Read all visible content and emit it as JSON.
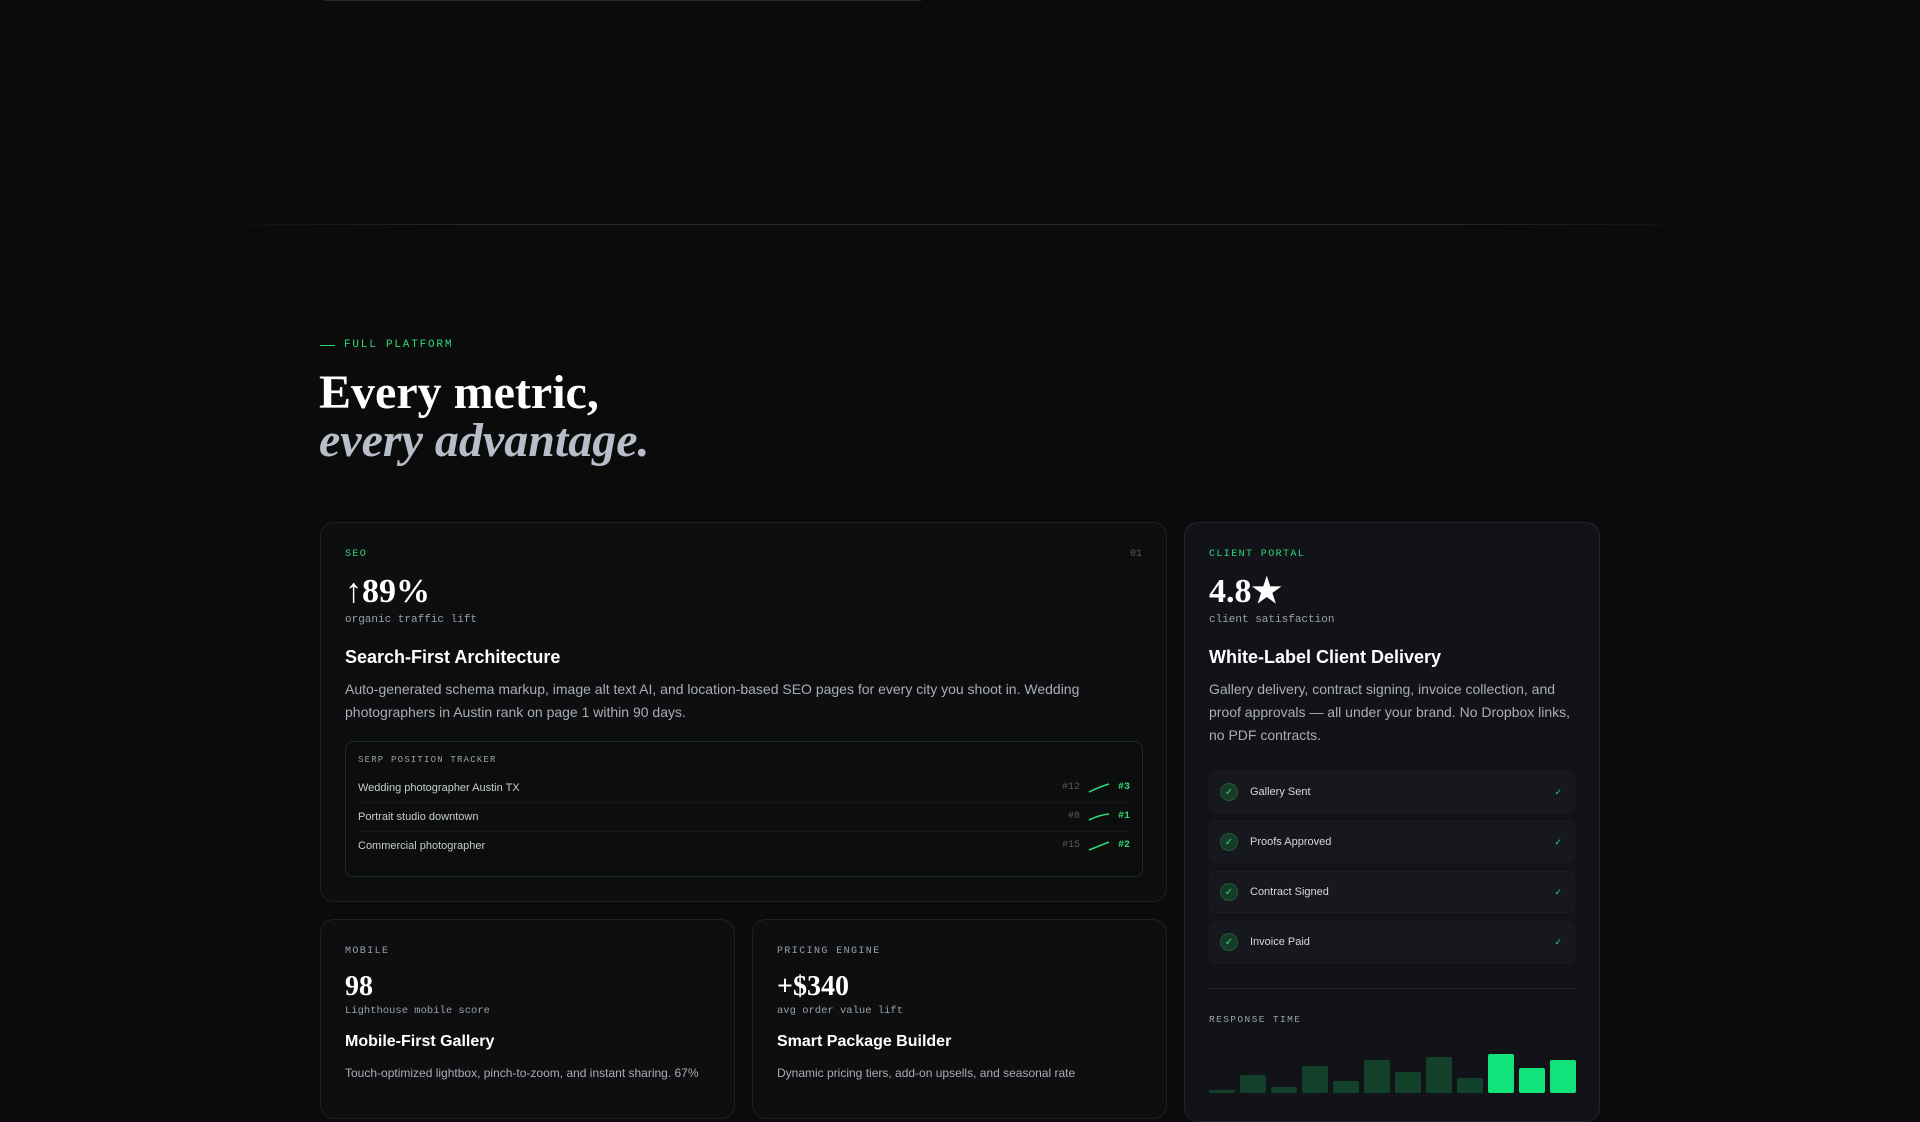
{
  "section": {
    "eyebrow": "FULL PLATFORM",
    "heading_line1": "Every metric,",
    "heading_line2": "every advantage."
  },
  "seo_card": {
    "tag": "SEO",
    "number": "01",
    "metric": "↑89%",
    "metric_label": "organic traffic lift",
    "title": "Search-First Architecture",
    "description": "Auto-generated schema markup, image alt text AI, and location-based SEO pages for every city you shoot in. Wedding photographers in Austin rank on page 1 within 90 days.",
    "tracker": {
      "label": "SERP POSITION TRACKER",
      "rows": [
        {
          "keyword": "Wedding photographer Austin TX",
          "from": "#12",
          "to": "#3"
        },
        {
          "keyword": "Portrait studio downtown",
          "from": "#8",
          "to": "#1"
        },
        {
          "keyword": "Commercial photographer",
          "from": "#15",
          "to": "#2"
        }
      ]
    }
  },
  "portal_card": {
    "tag": "CLIENT PORTAL",
    "metric": "4.8★",
    "metric_label": "client satisfaction",
    "title": "White-Label Client Delivery",
    "description": "Gallery delivery, contract signing, invoice collection, and proof approvals — all under your brand. No Dropbox links, no PDF contracts.",
    "statuses": [
      {
        "label": "Gallery Sent",
        "icon": "check-circle-icon"
      },
      {
        "label": "Proofs Approved",
        "icon": "check-circle-icon"
      },
      {
        "label": "Contract Signed",
        "icon": "check-circle-icon"
      },
      {
        "label": "Invoice Paid",
        "icon": "check-circle-icon"
      }
    ],
    "response_time_label": "RESPONSE TIME",
    "response_time_bars": [
      0.05,
      0.3,
      0.1,
      0.45,
      0.2,
      0.55,
      0.35,
      0.6,
      0.25,
      0.65,
      0.42,
      0.55
    ],
    "bar_colors": {
      "dim": "#13402b",
      "bright": "#12e27a"
    }
  },
  "mobile_card": {
    "tag": "MOBILE",
    "metric": "98",
    "metric_label": "Lighthouse mobile score",
    "title": "Mobile-First Gallery",
    "description": "Touch-optimized lightbox, pinch-to-zoom, and instant sharing. 67%"
  },
  "pricing_card": {
    "tag": "PRICING ENGINE",
    "metric": "+$340",
    "metric_label": "avg order value lift",
    "title": "Smart Package Builder",
    "description": "Dynamic pricing tiers, add-on upsells, and seasonal rate"
  },
  "colors": {
    "accent": "#2ed879",
    "background": "#0b0b0c"
  }
}
